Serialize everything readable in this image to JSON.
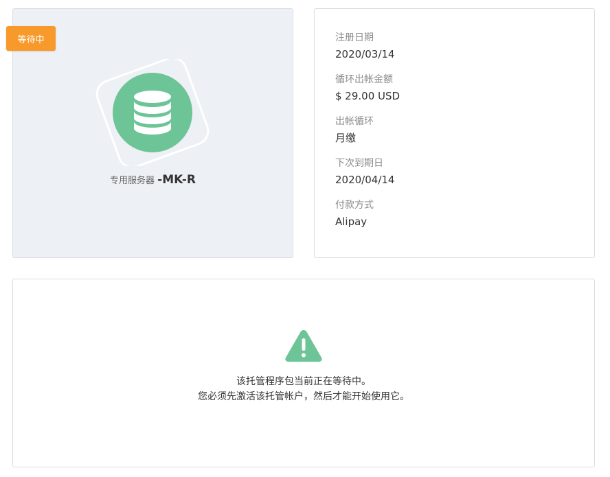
{
  "product": {
    "status_badge": "等待中",
    "server_label": "专用服务器",
    "server_name": "-MK-R",
    "icon": "database-icon",
    "icon_color": "#6dc497",
    "badge_color": "#f79a2b"
  },
  "details": {
    "registration_date_label": "注册日期",
    "registration_date": "2020/03/14",
    "recurring_amount_label": "循环出帐金额",
    "recurring_amount": "$ 29.00 USD",
    "billing_cycle_label": "出帐循环",
    "billing_cycle": "月缴",
    "next_due_label": "下次到期日",
    "next_due": "2020/04/14",
    "payment_method_label": "付款方式",
    "payment_method": "Alipay"
  },
  "notice": {
    "icon": "warning-icon",
    "line1": "该托管程序包当前正在等待中。",
    "line2": "您必须先激活该托管帐户，然后才能开始使用它。"
  }
}
